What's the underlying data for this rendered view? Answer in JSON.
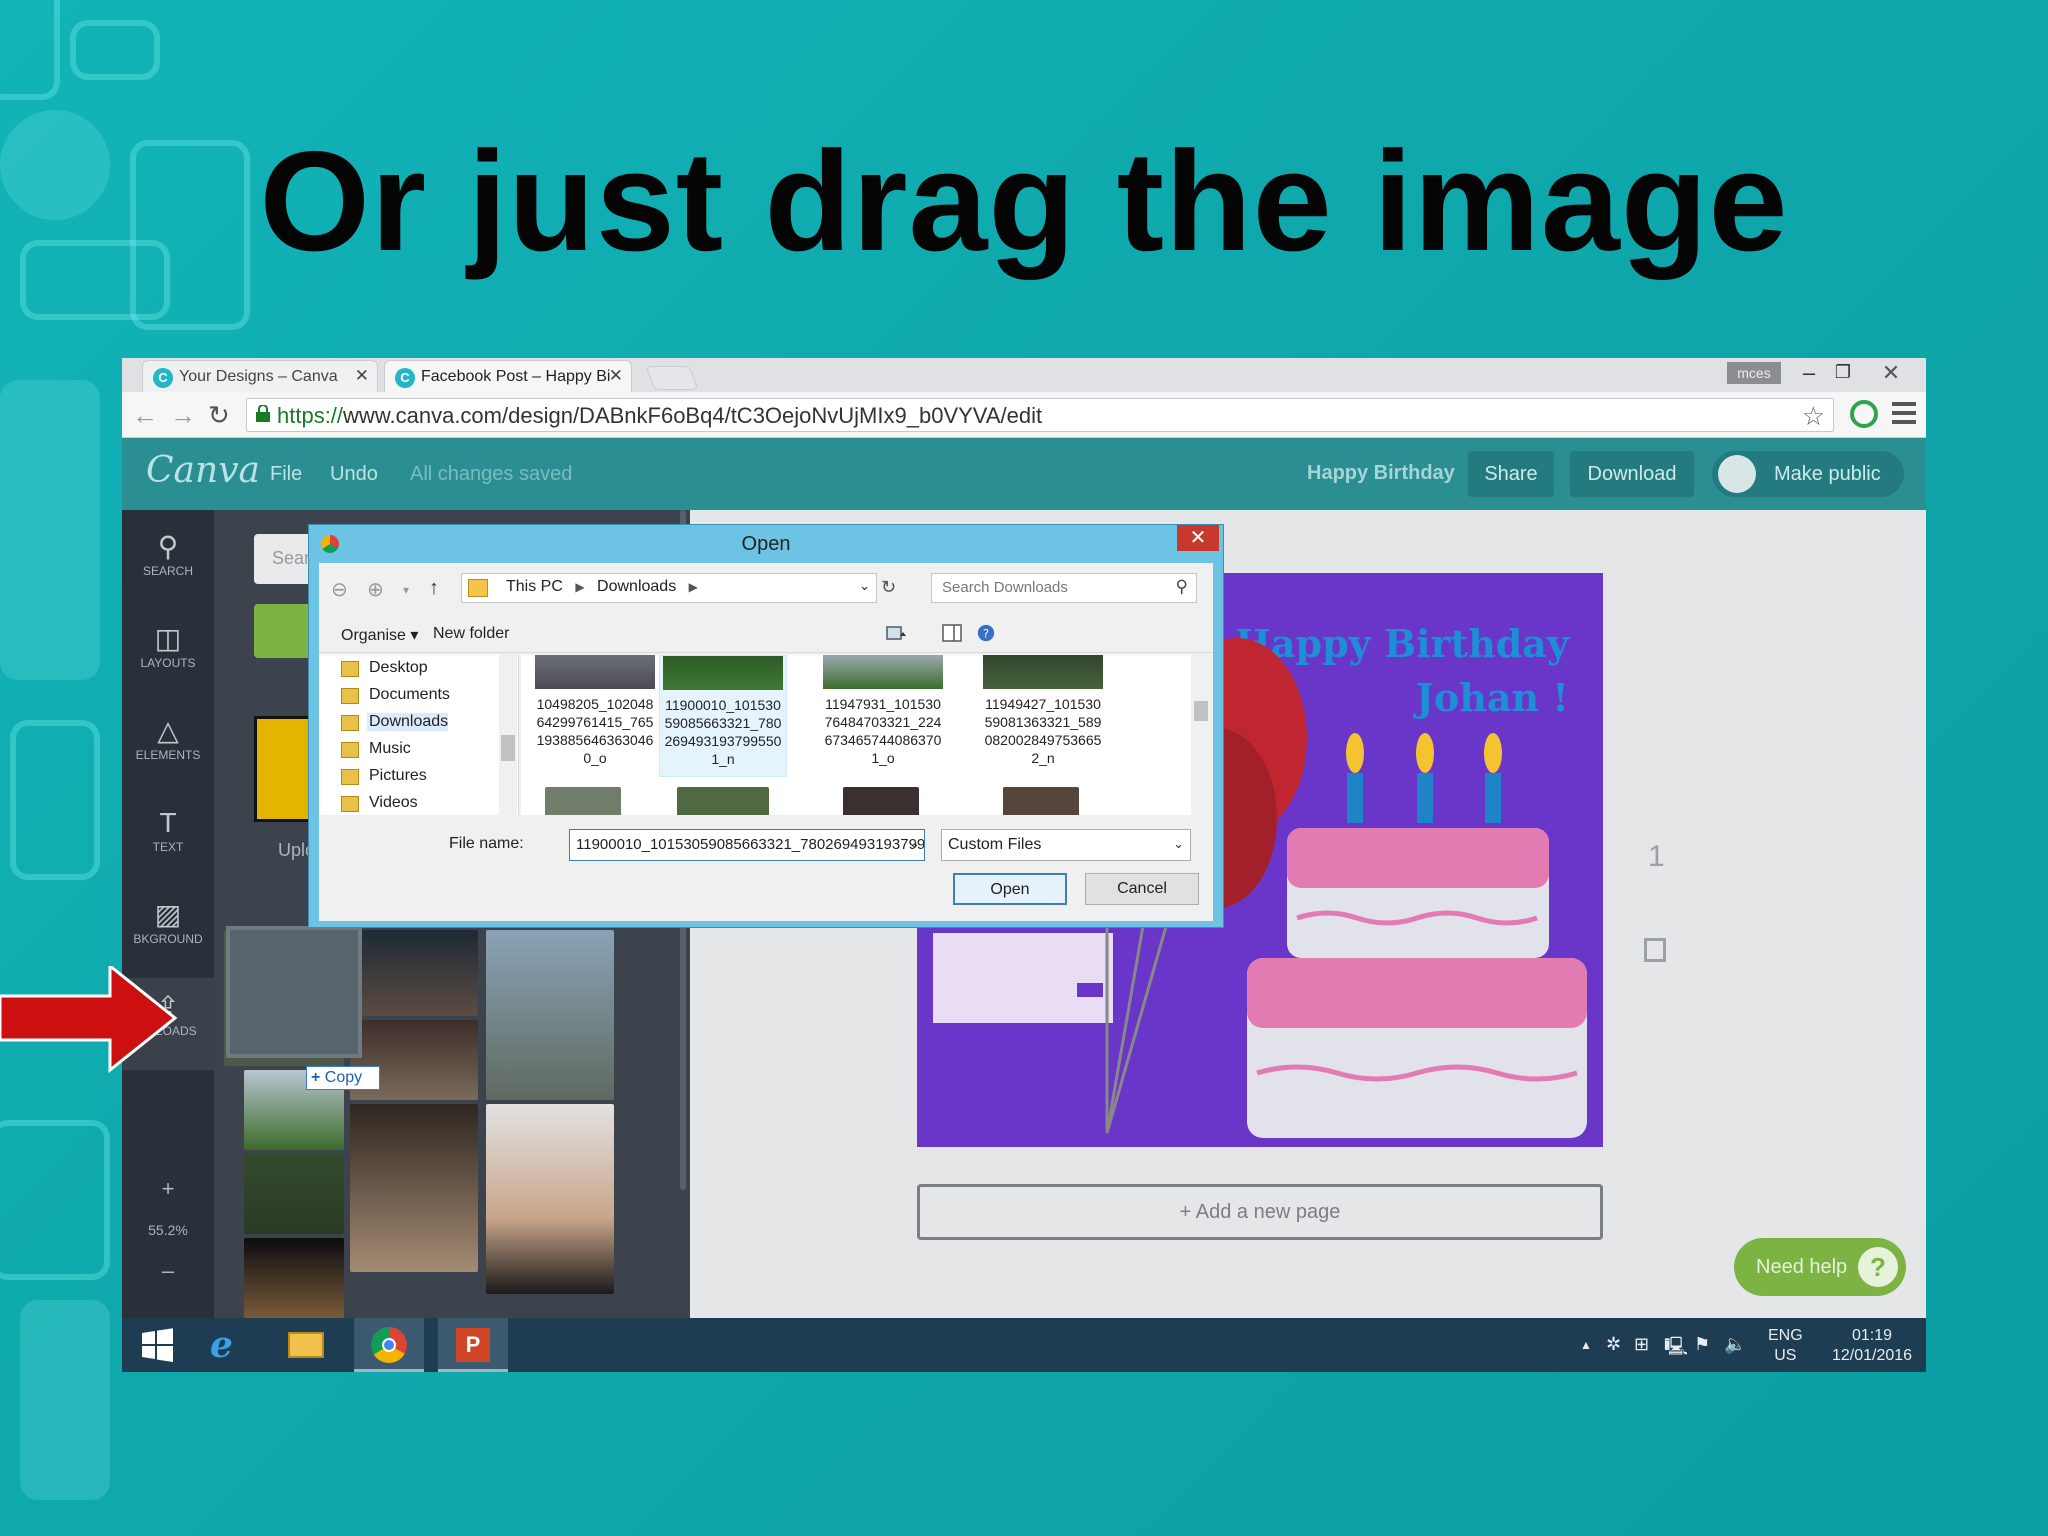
{
  "slide": {
    "title": "Or just drag the image"
  },
  "browser": {
    "tabs": [
      {
        "label": "Your Designs – Canva",
        "favicon": "C"
      },
      {
        "label": "Facebook Post – Happy Bi",
        "favicon": "C"
      }
    ],
    "user_badge": "mces",
    "url_scheme": "https://",
    "url_host": "www.canva.com",
    "url_path": "/design/DABnkF6oBq4/tC3OejoNvUjMIx9_b0VYVA/edit"
  },
  "canva": {
    "logo": "Canva",
    "menu": {
      "file": "File",
      "undo": "Undo",
      "status": "All changes saved"
    },
    "design_name": "Happy Birthday",
    "share_label": "Share",
    "download_label": "Download",
    "make_public_label": "Make public",
    "rail": [
      {
        "label": "SEARCH",
        "icon": "search-icon"
      },
      {
        "label": "LAYOUTS",
        "icon": "layouts-icon"
      },
      {
        "label": "ELEMENTS",
        "icon": "elements-icon"
      },
      {
        "label": "TEXT",
        "icon": "text-icon"
      },
      {
        "label": "BKGROUND",
        "icon": "background-icon"
      },
      {
        "label": "UPLOADS",
        "icon": "uploads-icon"
      }
    ],
    "zoom": "55.2%",
    "panel": {
      "search_placeholder": "Sear",
      "upload_label": "Uplc",
      "copy_label": "Copy"
    },
    "design_text_line1": "Happy Birthday",
    "design_text_line2": "Johan !",
    "add_page_label": "+ Add a new page",
    "page_number": "1",
    "need_help_label": "Need help"
  },
  "dialog": {
    "title": "Open",
    "breadcrumb": [
      "This PC",
      "Downloads"
    ],
    "search_placeholder": "Search Downloads",
    "organise_label": "Organise",
    "new_folder_label": "New folder",
    "tree": [
      "Desktop",
      "Documents",
      "Downloads",
      "Music",
      "Pictures",
      "Videos"
    ],
    "files": [
      {
        "name_lines": [
          "10498205_102048",
          "64299761415_765",
          "193885646363046",
          "0_o"
        ]
      },
      {
        "name_lines": [
          "11900010_101530",
          "59085663321_780",
          "269493193799550",
          "1_n"
        ]
      },
      {
        "name_lines": [
          "11947931_101530",
          "76484703321_224",
          "673465744086370",
          "1_o"
        ]
      },
      {
        "name_lines": [
          "11949427_101530",
          "59081363321_589",
          "082002849753665",
          "2_n"
        ]
      }
    ],
    "file_name_label": "File name:",
    "file_name_value": "11900010_10153059085663321_780269493193799",
    "file_type_value": "Custom Files",
    "open_label": "Open",
    "cancel_label": "Cancel"
  },
  "taskbar": {
    "apps": [
      "windows-start-icon",
      "internet-explorer-icon",
      "file-explorer-icon",
      "chrome-icon",
      "powerpoint-icon"
    ],
    "lang_line1": "ENG",
    "lang_line2": "US",
    "time": "01:19",
    "date": "12/01/2016"
  }
}
